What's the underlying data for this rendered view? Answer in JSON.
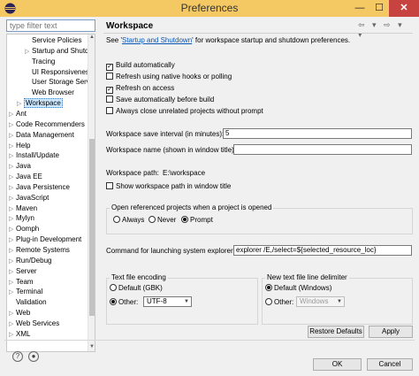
{
  "window": {
    "title": "Preferences"
  },
  "filter": {
    "placeholder": "type filter text"
  },
  "tree": {
    "items": [
      {
        "label": "Service Policies",
        "indent": 2,
        "arrow": false
      },
      {
        "label": "Startup and Shutdown",
        "indent": 2,
        "arrow": true
      },
      {
        "label": "Tracing",
        "indent": 2,
        "arrow": false
      },
      {
        "label": "UI Responsiveness",
        "indent": 2,
        "arrow": false
      },
      {
        "label": "User Storage Service",
        "indent": 2,
        "arrow": false
      },
      {
        "label": "Web Browser",
        "indent": 2,
        "arrow": false
      },
      {
        "label": "Workspace",
        "indent": 1,
        "arrow": true,
        "selected": true
      },
      {
        "label": "Ant",
        "indent": 0,
        "arrow": true
      },
      {
        "label": "Code Recommenders",
        "indent": 0,
        "arrow": true
      },
      {
        "label": "Data Management",
        "indent": 0,
        "arrow": true
      },
      {
        "label": "Help",
        "indent": 0,
        "arrow": true
      },
      {
        "label": "Install/Update",
        "indent": 0,
        "arrow": true
      },
      {
        "label": "Java",
        "indent": 0,
        "arrow": true
      },
      {
        "label": "Java EE",
        "indent": 0,
        "arrow": true
      },
      {
        "label": "Java Persistence",
        "indent": 0,
        "arrow": true
      },
      {
        "label": "JavaScript",
        "indent": 0,
        "arrow": true
      },
      {
        "label": "Maven",
        "indent": 0,
        "arrow": true
      },
      {
        "label": "Mylyn",
        "indent": 0,
        "arrow": true
      },
      {
        "label": "Oomph",
        "indent": 0,
        "arrow": true
      },
      {
        "label": "Plug-in Development",
        "indent": 0,
        "arrow": true
      },
      {
        "label": "Remote Systems",
        "indent": 0,
        "arrow": true
      },
      {
        "label": "Run/Debug",
        "indent": 0,
        "arrow": true
      },
      {
        "label": "Server",
        "indent": 0,
        "arrow": true
      },
      {
        "label": "Team",
        "indent": 0,
        "arrow": true
      },
      {
        "label": "Terminal",
        "indent": 0,
        "arrow": true
      },
      {
        "label": "Validation",
        "indent": 0,
        "arrow": false
      },
      {
        "label": "Web",
        "indent": 0,
        "arrow": true
      },
      {
        "label": "Web Services",
        "indent": 0,
        "arrow": true
      },
      {
        "label": "XML",
        "indent": 0,
        "arrow": true
      }
    ]
  },
  "page": {
    "title": "Workspace",
    "nav_arrows": "⇦ ▾ ⇨ ▾ ▾",
    "intro_prefix": "See '",
    "intro_link": "Startup and Shutdown",
    "intro_suffix": "' for workspace startup and shutdown preferences."
  },
  "options": {
    "build_auto": {
      "label": "Build automatically",
      "checked": true
    },
    "refresh_native": {
      "label": "Refresh using native hooks or polling",
      "checked": false
    },
    "refresh_access": {
      "label": "Refresh on access",
      "checked": true
    },
    "save_before_build": {
      "label": "Save automatically before build",
      "checked": false
    },
    "always_close": {
      "label": "Always close unrelated projects without prompt",
      "checked": false
    }
  },
  "save_interval": {
    "label": "Workspace save interval (in minutes):",
    "value": "5"
  },
  "workspace_name": {
    "label": "Workspace name (shown in window title):",
    "value": ""
  },
  "workspace_path": {
    "label": "Workspace path:",
    "value": "E:\\workspace"
  },
  "show_path": {
    "label": "Show workspace path in window title",
    "checked": false
  },
  "open_projects": {
    "title": "Open referenced projects when a project is opened",
    "always": "Always",
    "never": "Never",
    "prompt": "Prompt",
    "selected": "prompt"
  },
  "explorer": {
    "label": "Command for launching system explorer:",
    "value": "explorer /E,/select=${selected_resource_loc}"
  },
  "encoding": {
    "title": "Text file encoding",
    "default_label": "Default (GBK)",
    "other_label": "Other:",
    "other_value": "UTF-8",
    "selected": "other"
  },
  "delimiter": {
    "title": "New text file line delimiter",
    "default_label": "Default (Windows)",
    "other_label": "Other:",
    "other_value": "Windows",
    "selected": "default"
  },
  "buttons": {
    "restore": "Restore Defaults",
    "apply": "Apply",
    "ok": "OK",
    "cancel": "Cancel"
  },
  "colors": {
    "titlebar": "#f4c862",
    "close": "#c7433f",
    "selection": "#cde8ff",
    "link": "#0b57b5"
  }
}
